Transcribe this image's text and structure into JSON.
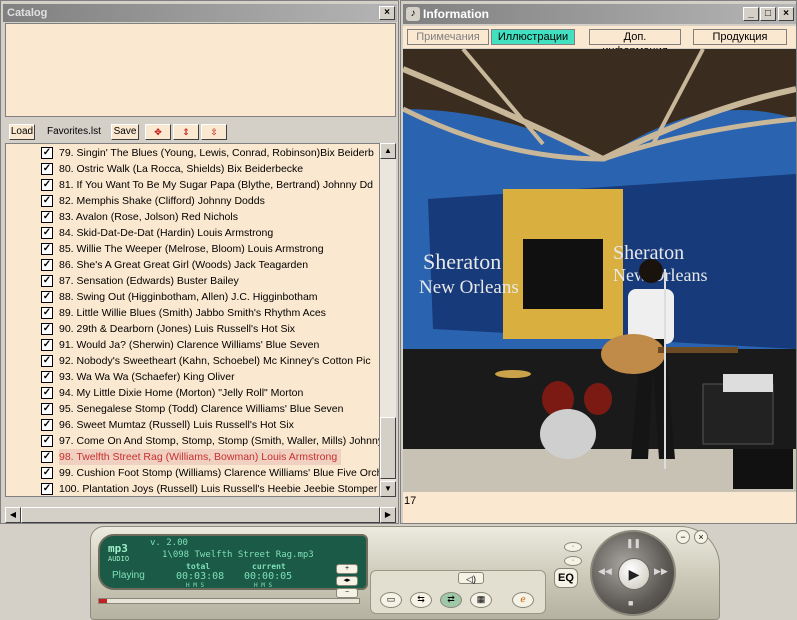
{
  "catalog": {
    "title": "Catalog",
    "close": "×",
    "toolbar": {
      "load": "Load",
      "list_name": "Favorites.lst",
      "save": "Save"
    },
    "rows": [
      "79. Singin' The Blues (Young, Lewis, Conrad, Robinson)Bix Beiderb",
      "80. Ostric Walk (La Rocca, Shields) Bix Beiderbecke",
      "81. If You Want To Be My Sugar Papa (Blythe, Bertrand) Johnny Dd",
      "82. Memphis Shake (Clifford) Johnny Dodds",
      "83. Avalon (Rose, Jolson) Red Nichols",
      "84. Skid-Dat-De-Dat (Hardin) Louis Armstrong",
      "85. Willie The Weeper (Melrose, Bloom) Louis Armstrong",
      "86. She's A Great Great Girl (Woods) Jack Teagarden",
      "87. Sensation (Edwards) Buster Bailey",
      "88. Swing Out (Higginbotham, Allen) J.C. Higginbotham",
      "89. Little Willie Blues (Smith) Jabbo Smith's Rhythm Aces",
      "90. 29th & Dearborn (Jones) Luis Russell's Hot Six",
      "91. Would Ja? (Sherwin) Clarence Williams' Blue Seven",
      "92. Nobody's Sweetheart (Kahn, Schoebel) Mc Kinney's Cotton Pic",
      "93. Wa Wa Wa (Schaefer) King Oliver",
      "94. My Little Dixie Home (Morton) \"Jelly Roll\" Morton",
      "95. Senegalese Stomp (Todd) Clarence Williams' Blue Seven",
      "96. Sweet Mumtaz (Russell) Luis Russell's Hot Six",
      "97. Come On And Stomp, Stomp, Stomp (Smith, Waller, Mills) Johnny",
      "98. Twelfth Street Rag (Williams, Bowman) Louis Armstrong",
      "99. Cushion Foot Stomp (Williams) Clarence Williams' Blue Five Orch",
      "100. Plantation Joys (Russell) Luis Russell's Heebie Jeebie Stomper"
    ],
    "selected_index": 19
  },
  "info": {
    "title": "Information",
    "tabs": [
      "Примечания",
      "Иллюстрации",
      "Доп. информация",
      "Продукция"
    ],
    "active_tab": 1,
    "caption": "17",
    "banner_text": "Sheraton New Orleans HOTEL",
    "colors": {
      "sky": "#2a64b0",
      "banner": "#173a7a",
      "stage": "#1a1a1a"
    }
  },
  "player": {
    "logo": "mp3",
    "logo_sub": "AUDIO",
    "version": "v. 2.00",
    "track": "1\\098 Twelfth Street Rag.mp3",
    "status": "Playing",
    "total_label": "total",
    "current_label": "current",
    "total_time": "00:03:08",
    "current_time": "00:00:05",
    "hms": "H   M   S",
    "eq": "EQ",
    "progress": 0.03
  }
}
